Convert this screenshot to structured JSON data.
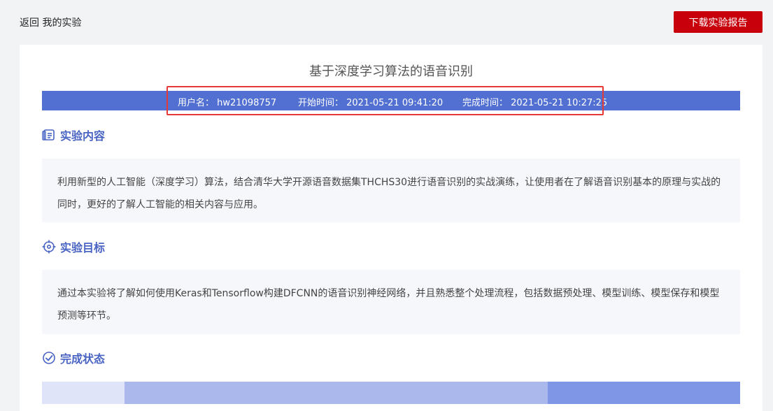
{
  "nav": {
    "back_label": "返回 我的实验",
    "download_label": "下载实验报告"
  },
  "report": {
    "title": "基于深度学习算法的语音识别",
    "info": {
      "username": "用户名： hw21098757",
      "start_time": "开始时间： 2021-05-21 09:41:20",
      "end_time": "完成时间： 2021-05-21 10:27:25"
    }
  },
  "sections": {
    "content": {
      "heading": "实验内容",
      "text": "利用新型的人工智能（深度学习）算法，结合清华大学开源语音数据集THCHS30进行语音识别的实战演练，让使用者在了解语音识别基本的原理与实战的同时，更好的了解人工智能的相关内容与应用。"
    },
    "goal": {
      "heading": "实验目标",
      "text": "通过本实验将了解如何使用Keras和Tensorflow构建DFCNN的语音识别神经网络，并且熟悉整个处理流程，包括数据预处理、模型训练、模型保存和模型预测等环节。"
    },
    "status": {
      "heading": "完成状态"
    }
  },
  "colors": {
    "accent": "#4a64c4",
    "info_bar": "#5270d2",
    "download_button": "#c7000b",
    "highlight_border": "#e53935",
    "progress_segments": [
      "#dfe4f8",
      "#aab8ec",
      "#7f95e6"
    ]
  },
  "icons": {
    "content": "document-icon",
    "goal": "target-icon",
    "status": "check-circle-icon"
  }
}
